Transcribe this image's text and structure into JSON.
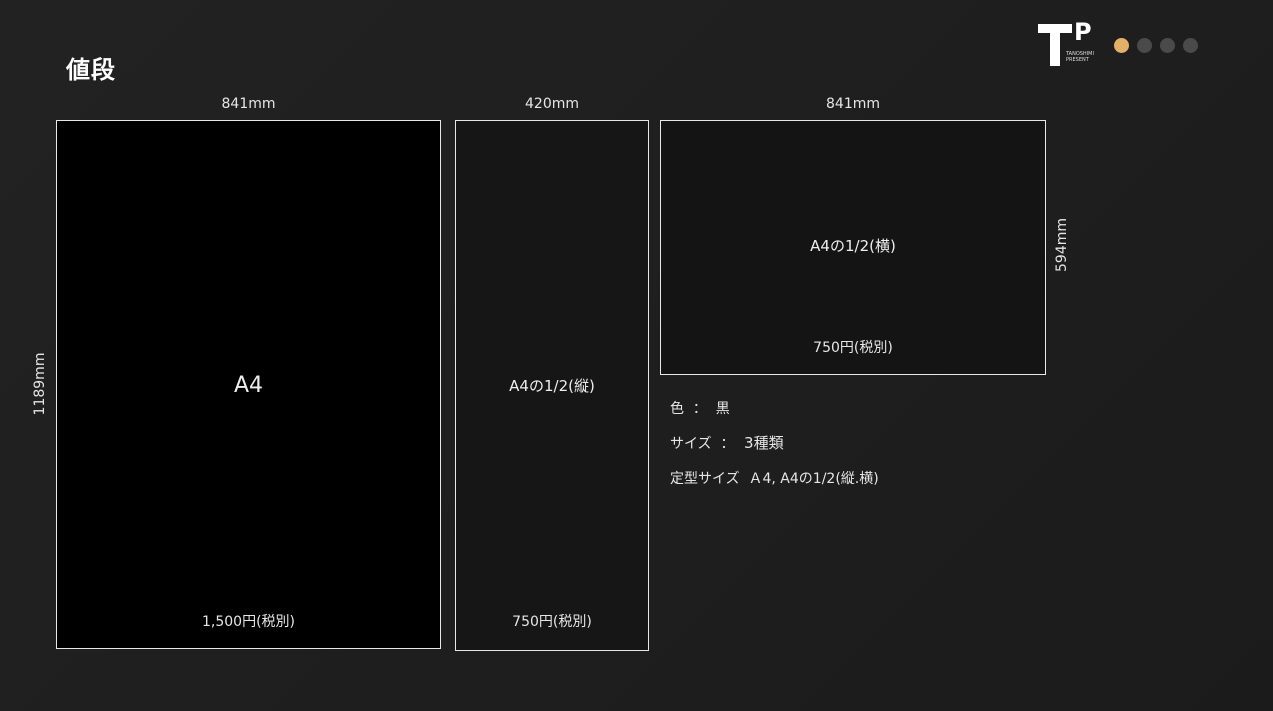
{
  "page": {
    "title": "値段"
  },
  "logo": {
    "mark_t": "T",
    "mark_p": "P",
    "sub_line1": "TANOSHIMI",
    "sub_line2": "PRESENT"
  },
  "pagination": {
    "total": 4,
    "active_index": 0,
    "active_color": "#e3b06a",
    "inactive_color": "#4a4a4a"
  },
  "panels": [
    {
      "name": "A4",
      "price": "1,500円(税別)",
      "width_label": "841mm",
      "height_label": "1189mm"
    },
    {
      "name": "A4の1/2(縦)",
      "price": "750円(税別)",
      "width_label": "420mm"
    },
    {
      "name": "A4の1/2(横)",
      "price": "750円(税別)",
      "width_label": "841mm",
      "height_label": "594mm"
    }
  ],
  "specs": {
    "color_label": "色  ：",
    "color_value": "  黒",
    "size_label": "サイズ  ：",
    "size_value": "  3種類",
    "standard_label": "定型サイズ",
    "standard_value": "  Ａ4, A4の1/2(縦.横)"
  }
}
